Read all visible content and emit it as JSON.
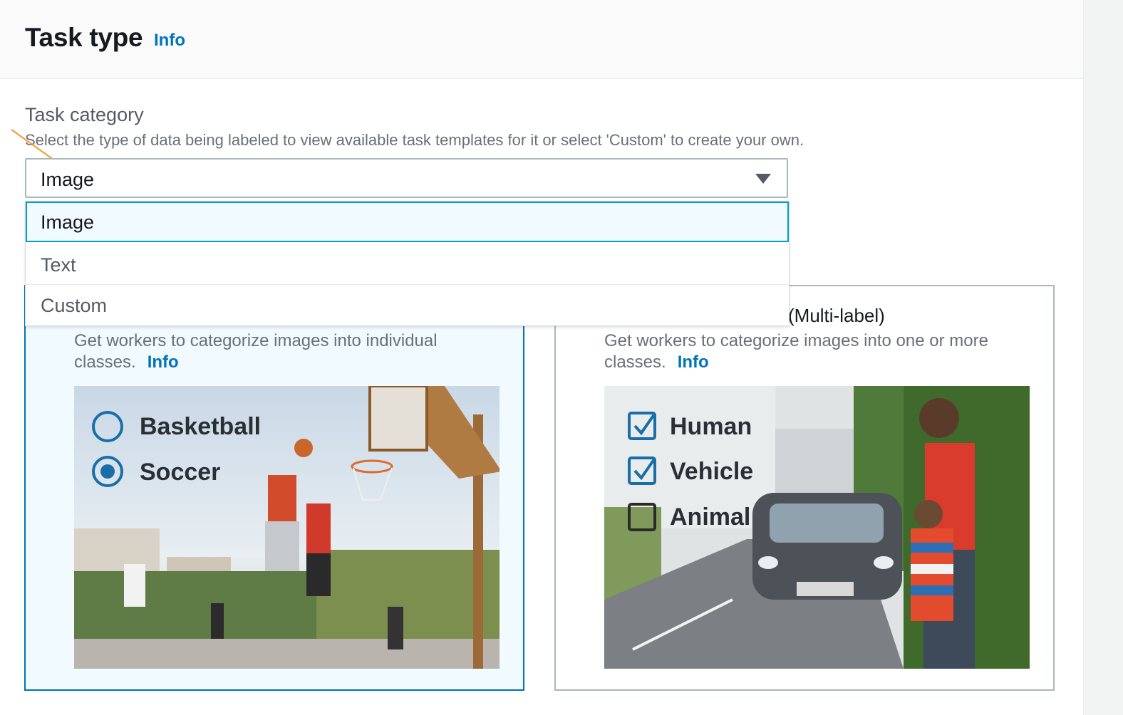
{
  "header": {
    "title": "Task type",
    "info_label": "Info"
  },
  "task_category": {
    "label": "Task category",
    "description": "Select the type of data being labeled to view available task templates for it or select 'Custom' to create your own.",
    "selected_value": "Image",
    "options": [
      "Image",
      "Text",
      "Custom"
    ]
  },
  "cards": [
    {
      "title": "",
      "description": "Get workers to categorize images into individual classes.",
      "info_label": "Info",
      "selected": true,
      "illustration": {
        "choices": [
          {
            "label": "Basketball",
            "checked": false
          },
          {
            "label": "Soccer",
            "checked": true
          }
        ]
      }
    },
    {
      "title": "(Multi-label)",
      "description": "Get workers to categorize images into one or more classes.",
      "info_label": "Info",
      "selected": false,
      "illustration": {
        "choices": [
          {
            "label": "Human",
            "checked": true
          },
          {
            "label": "Vehicle",
            "checked": true
          },
          {
            "label": "Animal",
            "checked": false
          }
        ]
      }
    }
  ],
  "colors": {
    "link": "#0073bb",
    "selected_border": "#00a1c9",
    "selected_bg": "#f1faff",
    "annotation_arrow": "#f29d38"
  }
}
